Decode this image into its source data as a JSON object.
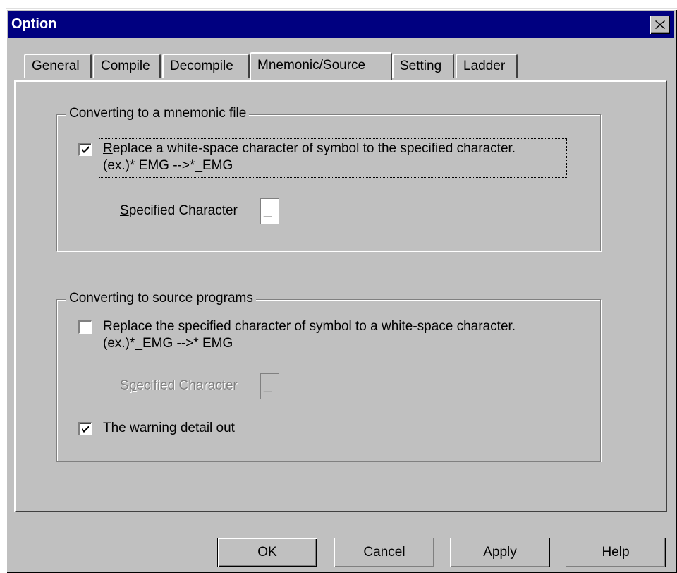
{
  "dialog": {
    "title": "Option",
    "close_icon": "close-x-icon"
  },
  "tabs": [
    {
      "label": "General",
      "active": false
    },
    {
      "label": "Compile",
      "active": false
    },
    {
      "label": "Decompile",
      "active": false
    },
    {
      "label": "Mnemonic/Source",
      "active": true
    },
    {
      "label": "Setting",
      "active": false
    },
    {
      "label": "Ladder",
      "active": false
    }
  ],
  "mnemonic_group": {
    "title": "Converting to a mnemonic file",
    "replace_checkbox": {
      "checked": true,
      "label_first_char": "R",
      "label_rest": "eplace a white-space character of symbol to the specified character.",
      "example": "(ex.)* EMG -->*_EMG"
    },
    "specified_char": {
      "label_first_char": "S",
      "label_rest": "pecified Character",
      "value": "_"
    }
  },
  "source_group": {
    "title": "Converting to source programs",
    "replace_checkbox": {
      "checked": false,
      "label": "Replace the specified character of symbol to a white-space character.",
      "example": "(ex.)*_EMG -->* EMG"
    },
    "specified_char": {
      "label_first_char": "S",
      "label_second_char": "p",
      "label_rest": "ecified Character",
      "value": "_",
      "enabled": false
    },
    "warning_checkbox": {
      "checked": true,
      "label": "The warning detail out"
    }
  },
  "buttons": {
    "ok": "OK",
    "cancel": "Cancel",
    "apply_first_char": "A",
    "apply_rest": "pply",
    "help": "Help"
  }
}
